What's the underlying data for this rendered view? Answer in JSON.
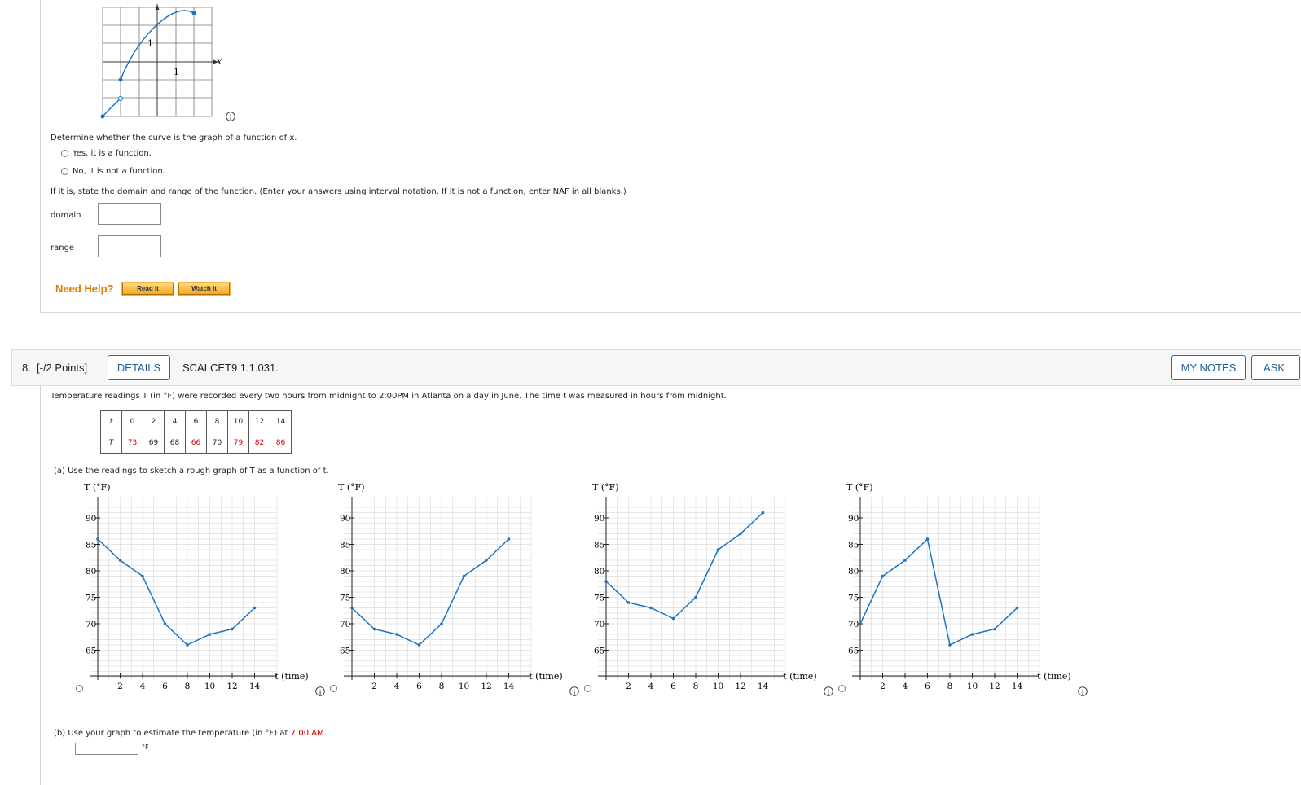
{
  "q7": {
    "fig_axis_x": "x",
    "fig_tick_x": "1",
    "fig_tick_y": "1",
    "prompt": "Determine whether the curve is the graph of a function of x.",
    "option_yes": "Yes, it is a function.",
    "option_no": "No, it is not a function.",
    "instruction": "If it is, state the domain and range of the function. (Enter your answers using interval notation. If it is not a function, enter NAF in all blanks.)",
    "domain_label": "domain",
    "range_label": "range",
    "domain_value": "",
    "range_value": "",
    "need_help": "Need Help?",
    "read_it": "Read It",
    "watch_it": "Watch It"
  },
  "q8": {
    "header": {
      "number": "8.",
      "points": "[-/2 Points]",
      "details": "DETAILS",
      "code": "SCALCET9 1.1.031.",
      "my_notes": "MY NOTES",
      "ask": "ASK"
    },
    "intro": "Temperature readings T (in °F) were recorded every two hours from midnight to 2:00PM in Atlanta on a day in June. The time t was measured in hours from midnight.",
    "table": {
      "t_label": "t",
      "T_label": "T",
      "t": [
        "0",
        "2",
        "4",
        "6",
        "8",
        "10",
        "12",
        "14"
      ],
      "T": [
        "73",
        "69",
        "68",
        "66",
        "70",
        "79",
        "82",
        "86"
      ],
      "T_red": [
        true,
        false,
        false,
        true,
        false,
        true,
        true,
        true
      ]
    },
    "part_a": "(a)  Use the readings to sketch a rough graph of T as a function of t.",
    "part_b_prompt": "(b)  Use your graph to estimate the temperature (in °F) at 7:00 AM.",
    "part_b_unit": "°F",
    "part_b_value": ""
  },
  "chart_data": [
    {
      "type": "line",
      "ylabel": "T (°F)",
      "xlabel": "t (time)",
      "xlim": [
        0,
        16
      ],
      "ylim": [
        60,
        92
      ],
      "x": [
        0,
        2,
        4,
        6,
        8,
        10,
        12,
        14
      ],
      "series": [
        {
          "values": [
            86,
            82,
            79,
            70,
            66,
            68,
            69,
            73
          ]
        }
      ],
      "xticks": [
        2,
        4,
        6,
        8,
        10,
        12,
        14
      ],
      "yticks": [
        65,
        70,
        75,
        80,
        85,
        90
      ]
    },
    {
      "type": "line",
      "ylabel": "T (°F)",
      "xlabel": "t (time)",
      "xlim": [
        0,
        16
      ],
      "ylim": [
        60,
        92
      ],
      "x": [
        0,
        2,
        4,
        6,
        8,
        10,
        12,
        14
      ],
      "series": [
        {
          "values": [
            73,
            69,
            68,
            66,
            70,
            79,
            82,
            86
          ]
        }
      ],
      "xticks": [
        2,
        4,
        6,
        8,
        10,
        12,
        14
      ],
      "yticks": [
        65,
        70,
        75,
        80,
        85,
        90
      ]
    },
    {
      "type": "line",
      "ylabel": "T (°F)",
      "xlabel": "t (time)",
      "xlim": [
        0,
        16
      ],
      "ylim": [
        60,
        92
      ],
      "x": [
        0,
        2,
        4,
        6,
        8,
        10,
        12,
        14
      ],
      "series": [
        {
          "values": [
            78,
            74,
            73,
            71,
            75,
            84,
            87,
            91
          ]
        }
      ],
      "xticks": [
        2,
        4,
        6,
        8,
        10,
        12,
        14
      ],
      "yticks": [
        65,
        70,
        75,
        80,
        85,
        90
      ]
    },
    {
      "type": "line",
      "ylabel": "T (°F)",
      "xlabel": "t (time)",
      "xlim": [
        0,
        16
      ],
      "ylim": [
        60,
        92
      ],
      "x": [
        0,
        2,
        4,
        6,
        8,
        10,
        12,
        14
      ],
      "series": [
        {
          "values": [
            70,
            79,
            82,
            86,
            66,
            68,
            69,
            73
          ]
        }
      ],
      "xticks": [
        2,
        4,
        6,
        8,
        10,
        12,
        14
      ],
      "yticks": [
        65,
        70,
        75,
        80,
        85,
        90
      ]
    }
  ],
  "colors": {
    "curve": "#1a73c4",
    "red": "#d40000",
    "link": "#1f5c99",
    "help": "#e07b00"
  }
}
